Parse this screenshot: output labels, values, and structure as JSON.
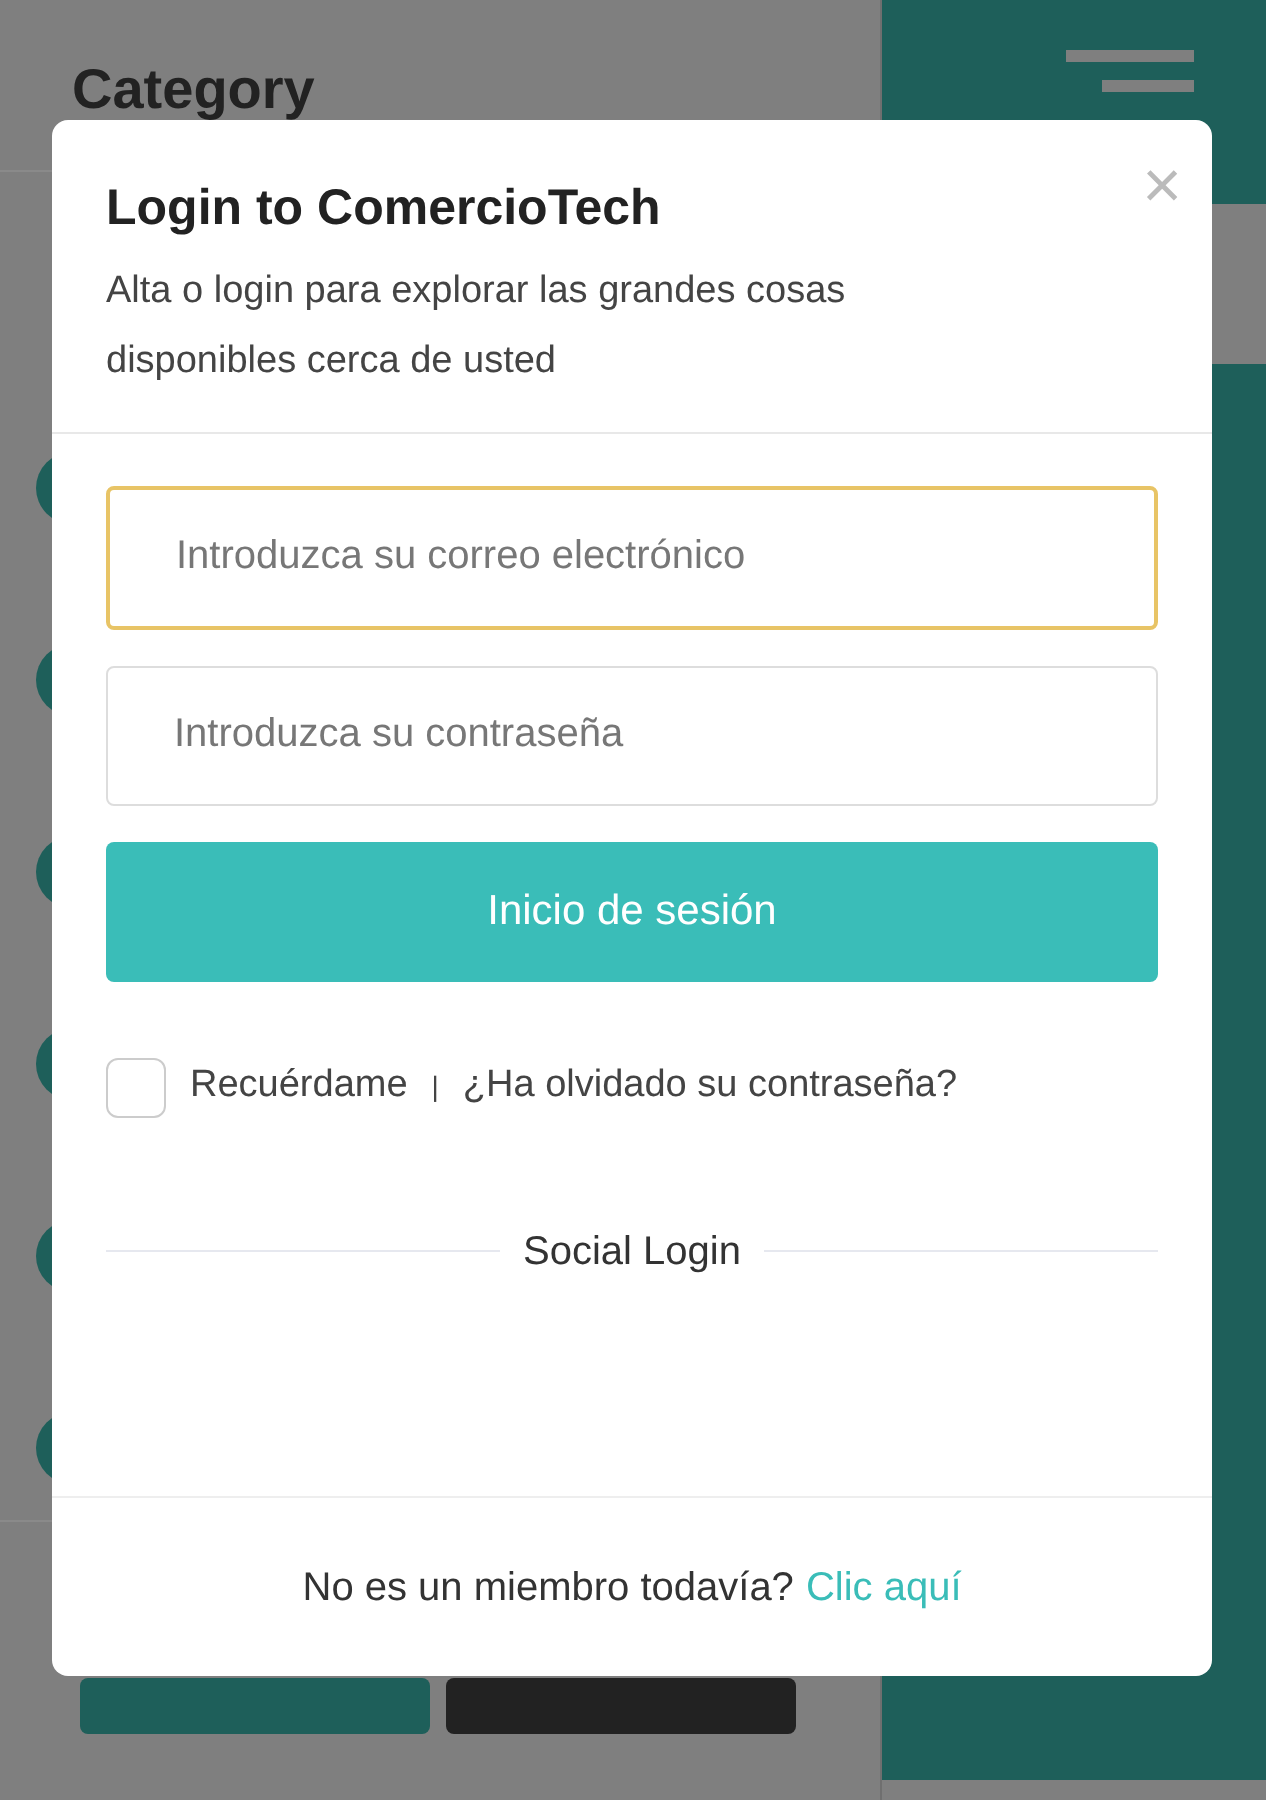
{
  "page": {
    "heading": "Category"
  },
  "modal": {
    "title": "Login to ComercioTech",
    "subtitle": "Alta o login para explorar las grandes cosas disponibles cerca de usted",
    "close": "×",
    "email": {
      "placeholder": "Introduzca su correo electrónico"
    },
    "password": {
      "placeholder": "Introduzca su contraseña"
    },
    "submit": "Inicio de sesión",
    "remember": {
      "label": "Recuérdame",
      "checked": false
    },
    "separator": "|",
    "forgot": "¿Ha olvidado su contraseña?",
    "social": "Social Login",
    "footer": {
      "text": "No es un miembro todavía?",
      "link": "Clic aquí"
    }
  }
}
